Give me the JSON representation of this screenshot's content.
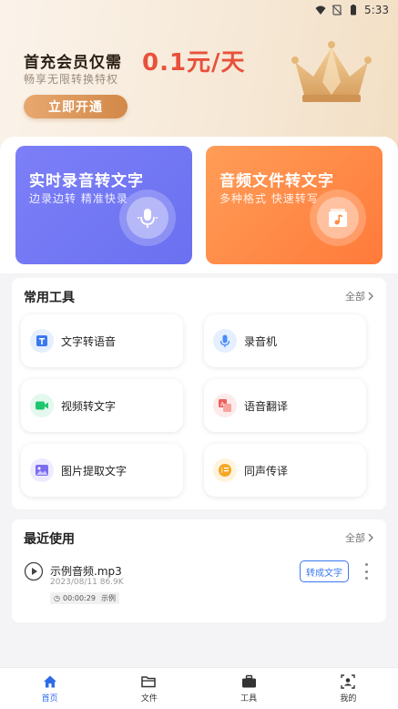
{
  "status_bar": {
    "time": "5:33"
  },
  "banner": {
    "title": "首充会员仅需",
    "price": "0.1元/天",
    "subtitle": "畅享无限转换特权",
    "button_label": "立即开通"
  },
  "features": [
    {
      "title": "实时录音转文字",
      "subtitle": "边录边转  精准快录",
      "icon": "microphone-icon"
    },
    {
      "title": "音频文件转文字",
      "subtitle": "多种格式  快速转写",
      "icon": "music-file-icon"
    }
  ],
  "tools": {
    "title": "常用工具",
    "more_label": "全部",
    "items": [
      {
        "label": "文字转语音",
        "icon": "text-to-speech-icon"
      },
      {
        "label": "录音机",
        "icon": "recorder-icon"
      },
      {
        "label": "视频转文字",
        "icon": "video-icon"
      },
      {
        "label": "语音翻译",
        "icon": "translate-icon"
      },
      {
        "label": "图片提取文字",
        "icon": "image-icon"
      },
      {
        "label": "同声传译",
        "icon": "interpret-icon"
      }
    ]
  },
  "recent": {
    "title": "最近使用",
    "more_label": "全部",
    "item": {
      "name": "示例音频.mp3",
      "meta": "2023/08/11 86.9K",
      "duration": "00:00:29",
      "tag": "示例",
      "convert_label": "转成文字"
    }
  },
  "nav": [
    {
      "label": "首页",
      "icon": "home-icon",
      "active": true
    },
    {
      "label": "文件",
      "icon": "folder-icon",
      "active": false
    },
    {
      "label": "工具",
      "icon": "toolbox-icon",
      "active": false
    },
    {
      "label": "我的",
      "icon": "profile-icon",
      "active": false
    }
  ],
  "colors": {
    "accent_blue": "#2f6be8",
    "promo_red": "#e8513a",
    "card_blue": "#7c7ff7",
    "card_orange": "#ff8a45"
  }
}
